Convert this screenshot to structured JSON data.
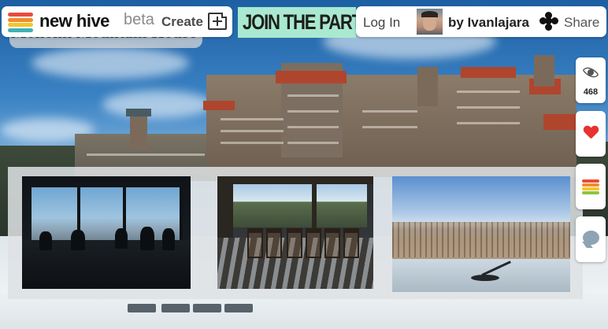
{
  "nav": {
    "brand": "new hive",
    "beta": "beta",
    "create_label": "Create",
    "login_label": "Log In",
    "byline": "by Ivanlajara",
    "share_label": "Share"
  },
  "banner": {
    "text": "JOIN THE PART"
  },
  "page": {
    "title": "Mohonk Mountain House"
  },
  "sidebar": {
    "views_count": "468"
  },
  "colors": {
    "logo_stripes": [
      "#e94b3c",
      "#f08d2d",
      "#f5c52b",
      "#8cc63f",
      "#3fb1b5"
    ],
    "banner_bg": "#a9e9d0",
    "heart": "#e8322f"
  },
  "icons": [
    "create-page-icon",
    "share-icon",
    "eye-icon",
    "heart-icon",
    "hive-logo-icon",
    "comment-icon"
  ],
  "gallery": {
    "photos": [
      "dining-room-window-view",
      "porch-rocking-chairs",
      "frozen-pool-sundial"
    ]
  }
}
